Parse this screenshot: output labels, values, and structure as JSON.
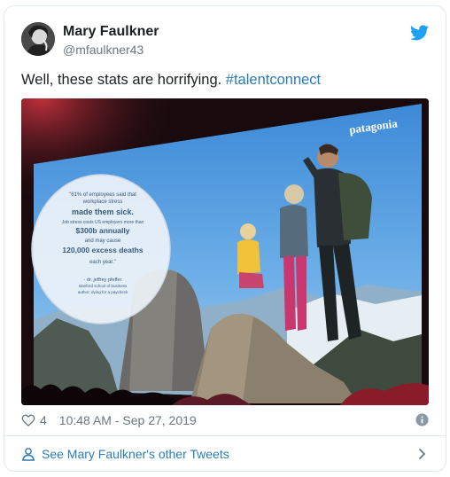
{
  "author": {
    "name": "Mary Faulkner",
    "handle": "@mfaulkner43"
  },
  "tweet": {
    "text_before_hashtag": "Well, these stats are horrifying. ",
    "hashtag": "#talentconnect"
  },
  "slide": {
    "brand": "patagonia",
    "quote_line1": "\"61% of employees said that",
    "quote_line2": "workplace stress",
    "quote_line3": "made them sick.",
    "quote_line4": "Job stress costs US employers more than",
    "quote_line5": "$300b annually",
    "quote_line6": "and may cause",
    "quote_line7": "120,000 excess deaths",
    "quote_line8": "each year.\"",
    "attribution1": "- dr. jeffrey pfeffer",
    "attribution2": "stanford school of business",
    "attribution3": "author: dying for a paycheck"
  },
  "meta": {
    "like_count": "4",
    "timestamp": "10:48 AM - Sep 27, 2019"
  },
  "footer": {
    "see_more_label": "See Mary Faulkner's other Tweets"
  },
  "colors": {
    "link": "#2b7bb9",
    "twitter_blue": "#1da1f2",
    "muted": "#697882",
    "border": "#e1e8ed"
  },
  "icons": [
    "twitter-logo-icon",
    "heart-icon",
    "info-icon",
    "person-icon",
    "chevron-right-icon"
  ]
}
